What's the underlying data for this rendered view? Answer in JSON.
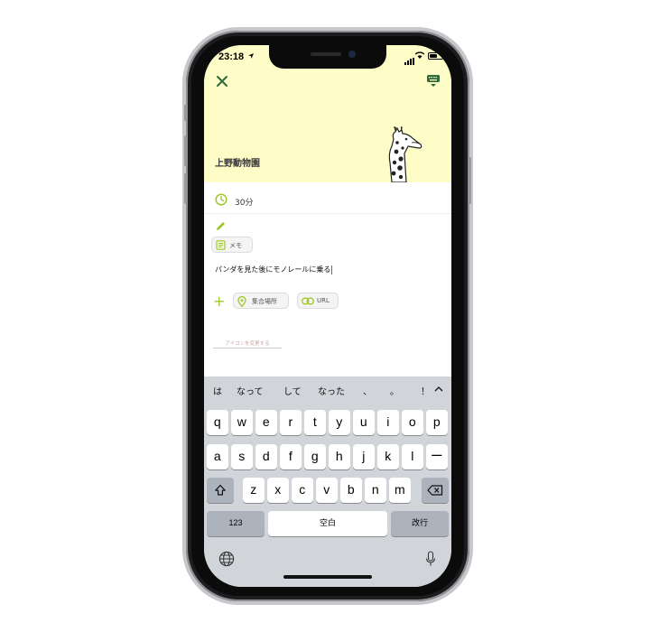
{
  "status_bar": {
    "time": "23:18",
    "location_arrow": "➤"
  },
  "header": {
    "close_icon": "close-icon",
    "keyboard_icon": "keyboard-dismiss-icon",
    "title": "上野動物園",
    "illustration": "giraffe-illustration"
  },
  "duration": {
    "icon": "clock-icon",
    "value": "30分"
  },
  "memo": {
    "edit_icon": "pencil-icon",
    "chip_label": "メモ",
    "text": "パンダを見た後にモノレールに乗る"
  },
  "add_row": {
    "plus": "+",
    "meeting_place_label": "集合場所",
    "url_label": "URL"
  },
  "change_icon_link": "アイコンを変更する",
  "keyboard": {
    "candidates": [
      "は",
      "なって",
      "して",
      "なった",
      "、",
      "。",
      "！"
    ],
    "expand_icon": "chevron-up-icon",
    "row1": [
      "q",
      "w",
      "e",
      "r",
      "t",
      "y",
      "u",
      "i",
      "o",
      "p"
    ],
    "row2": [
      "a",
      "s",
      "d",
      "f",
      "g",
      "h",
      "j",
      "k",
      "l",
      "ー"
    ],
    "row3": [
      "z",
      "x",
      "c",
      "v",
      "b",
      "n",
      "m"
    ],
    "numbers_label": "123",
    "space_label": "空白",
    "return_label": "改行",
    "shift_icon": "shift-icon",
    "delete_icon": "delete-icon",
    "globe_icon": "globe-icon",
    "mic_icon": "microphone-icon"
  },
  "colors": {
    "accent": "#9ec82a",
    "header_bg": "#fefdc8",
    "keyboard_bg": "#d1d4d9",
    "dark_green": "#2e6b3a"
  }
}
